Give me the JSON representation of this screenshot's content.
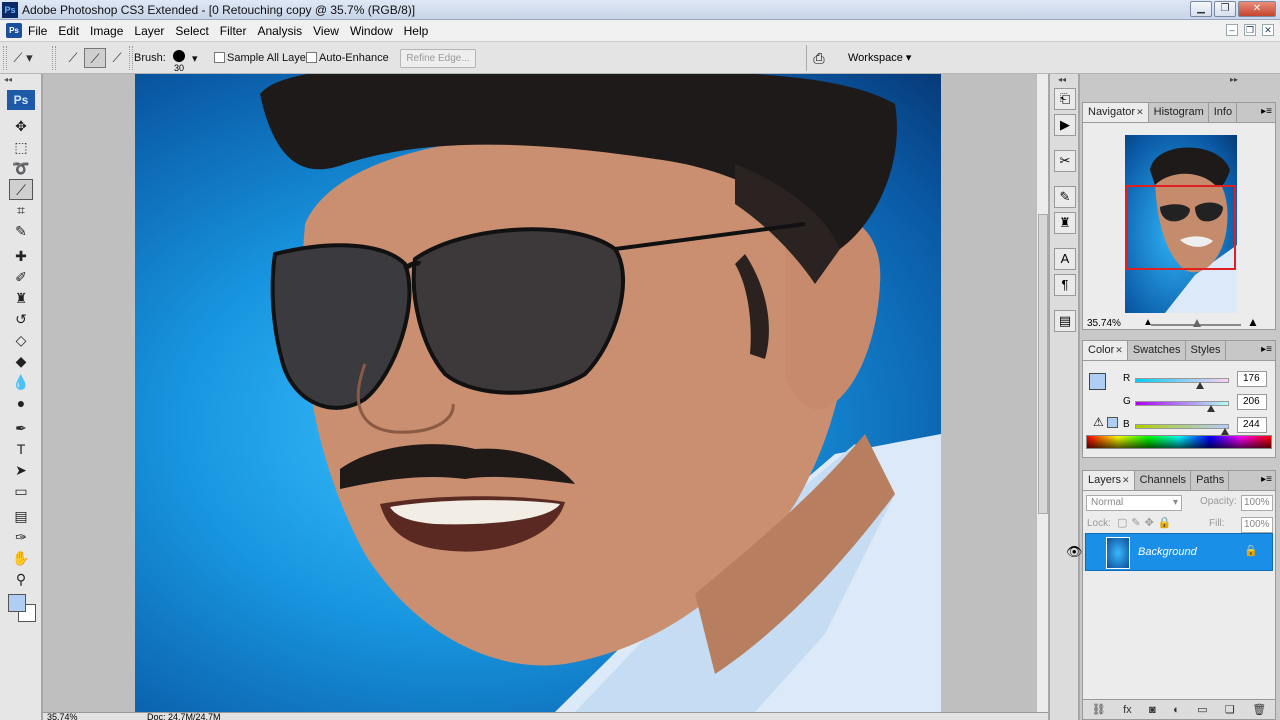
{
  "app": {
    "title": "Adobe Photoshop CS3 Extended - [0  Retouching copy @ 35.7% (RGB/8)]",
    "logo": "Ps"
  },
  "menubar": {
    "doc_icon": "Ps",
    "items": [
      "File",
      "Edit",
      "Image",
      "Layer",
      "Select",
      "Filter",
      "Analysis",
      "View",
      "Window",
      "Help"
    ]
  },
  "options": {
    "brush_label": "Brush:",
    "brush_size": "30",
    "sample_all_layers": "Sample All Layers",
    "auto_enhance": "Auto-Enhance",
    "refine_edge": "Refine Edge...",
    "workspace": "Workspace"
  },
  "toolbox": {
    "badge": "Ps",
    "tools": [
      {
        "name": "move-tool-icon",
        "glyph": "✥"
      },
      {
        "name": "marquee-tool-icon",
        "glyph": "⬚"
      },
      {
        "name": "lasso-tool-icon",
        "glyph": "➰"
      },
      {
        "name": "quick-selection-tool-icon",
        "glyph": "⟋"
      },
      {
        "name": "crop-tool-icon",
        "glyph": "⌗"
      },
      {
        "name": "slice-tool-icon",
        "glyph": "✎"
      },
      {
        "name": "healing-brush-tool-icon",
        "glyph": "✚"
      },
      {
        "name": "brush-tool-icon",
        "glyph": "✐"
      },
      {
        "name": "clone-stamp-tool-icon",
        "glyph": "♜"
      },
      {
        "name": "history-brush-tool-icon",
        "glyph": "↺"
      },
      {
        "name": "eraser-tool-icon",
        "glyph": "◇"
      },
      {
        "name": "paint-bucket-tool-icon",
        "glyph": "◆"
      },
      {
        "name": "blur-tool-icon",
        "glyph": "💧"
      },
      {
        "name": "dodge-tool-icon",
        "glyph": "●"
      },
      {
        "name": "pen-tool-icon",
        "glyph": "✒"
      },
      {
        "name": "type-tool-icon",
        "glyph": "T"
      },
      {
        "name": "path-selection-tool-icon",
        "glyph": "➤"
      },
      {
        "name": "shape-tool-icon",
        "glyph": "▭"
      },
      {
        "name": "notes-tool-icon",
        "glyph": "▤"
      },
      {
        "name": "eyedropper-tool-icon",
        "glyph": "✑"
      },
      {
        "name": "hand-tool-icon",
        "glyph": "✋"
      },
      {
        "name": "zoom-tool-icon",
        "glyph": "⚲"
      }
    ]
  },
  "status": {
    "zoom": "35.74%",
    "doc": "Doc: 24.7M/24.7M"
  },
  "navigator": {
    "tabs": [
      "Navigator",
      "Histogram",
      "Info"
    ],
    "zoom": "35.74%"
  },
  "color": {
    "tabs": [
      "Color",
      "Swatches",
      "Styles"
    ],
    "r_label": "R",
    "g_label": "G",
    "b_label": "B",
    "r": "176",
    "g": "206",
    "b": "244",
    "foreground_hex": "#b0cef4",
    "channels": {
      "r": 176,
      "g": 206,
      "b": 244
    }
  },
  "layers": {
    "tabs": [
      "Layers",
      "Channels",
      "Paths"
    ],
    "blend_mode": "Normal",
    "opacity_label": "Opacity:",
    "opacity": "100%",
    "lock_label": "Lock:",
    "fill_label": "Fill:",
    "fill": "100%",
    "items": [
      {
        "name": "Background",
        "selected": true,
        "locked": true
      }
    ]
  },
  "colors": {
    "selection": "#1a8fe8",
    "photo_bg": "#1896e0"
  }
}
